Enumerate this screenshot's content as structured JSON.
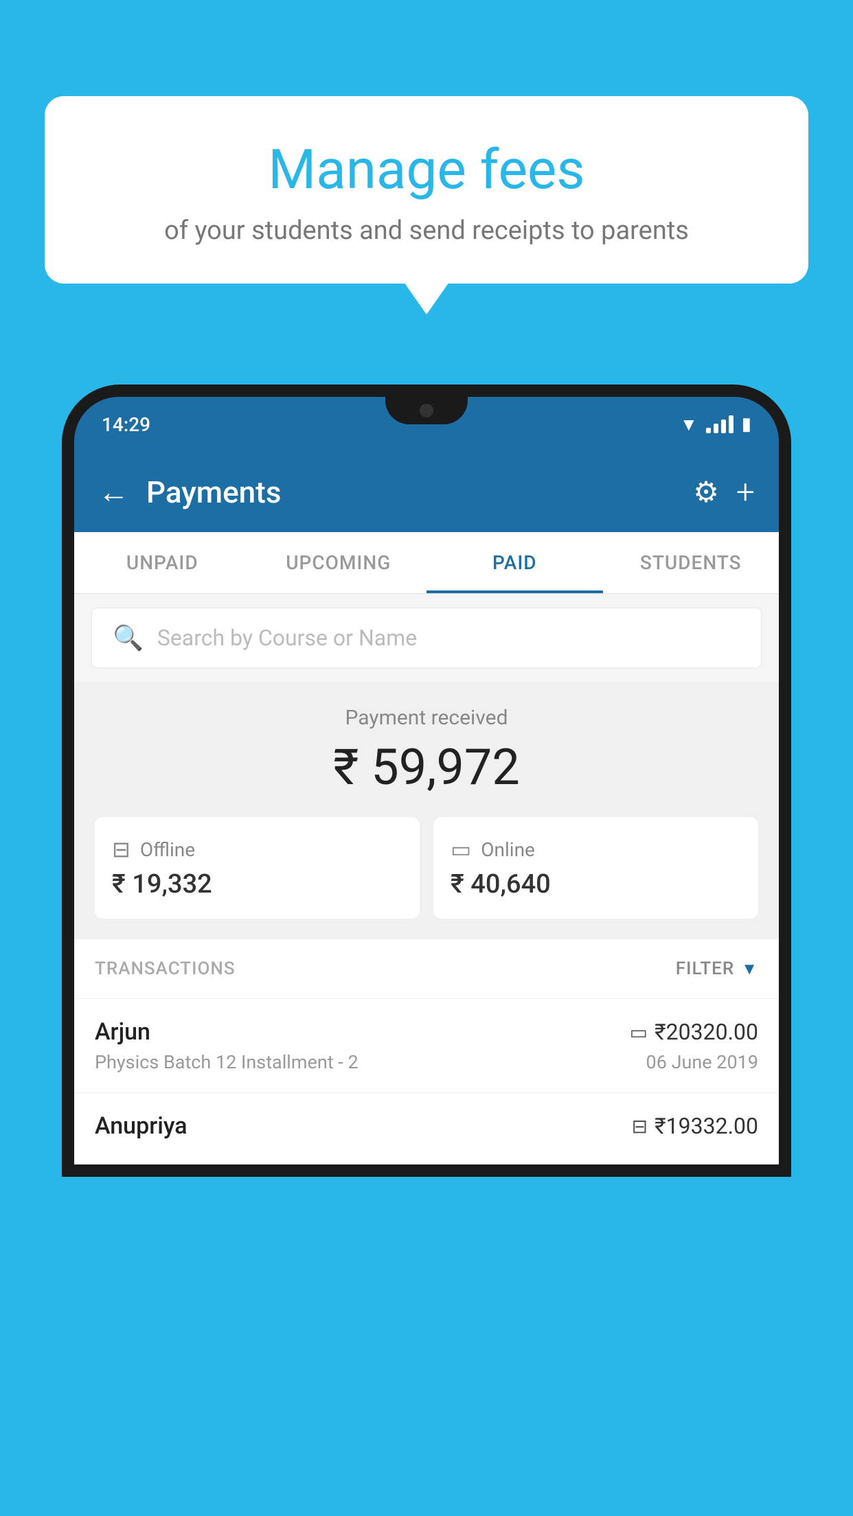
{
  "background_color": "#29b6e8",
  "bubble": {
    "title": "Manage fees",
    "subtitle": "of your students and send receipts to parents"
  },
  "phone": {
    "status_bar": {
      "time": "14:29"
    },
    "header": {
      "title": "Payments",
      "back_label": "←",
      "plus_label": "+"
    },
    "tabs": [
      {
        "label": "UNPAID",
        "active": false
      },
      {
        "label": "UPCOMING",
        "active": false
      },
      {
        "label": "PAID",
        "active": true
      },
      {
        "label": "STUDENTS",
        "active": false
      }
    ],
    "search": {
      "placeholder": "Search by Course or Name"
    },
    "payment_received": {
      "label": "Payment received",
      "amount": "₹ 59,972",
      "offline": {
        "type": "Offline",
        "amount": "₹ 19,332"
      },
      "online": {
        "type": "Online",
        "amount": "₹ 40,640"
      }
    },
    "transactions": {
      "label": "TRANSACTIONS",
      "filter_label": "FILTER",
      "items": [
        {
          "name": "Arjun",
          "amount": "₹20320.00",
          "course": "Physics Batch 12 Installment - 2",
          "date": "06 June 2019",
          "payment_type": "card"
        },
        {
          "name": "Anupriya",
          "amount": "₹19332.00",
          "course": "",
          "date": "",
          "payment_type": "offline"
        }
      ]
    }
  }
}
